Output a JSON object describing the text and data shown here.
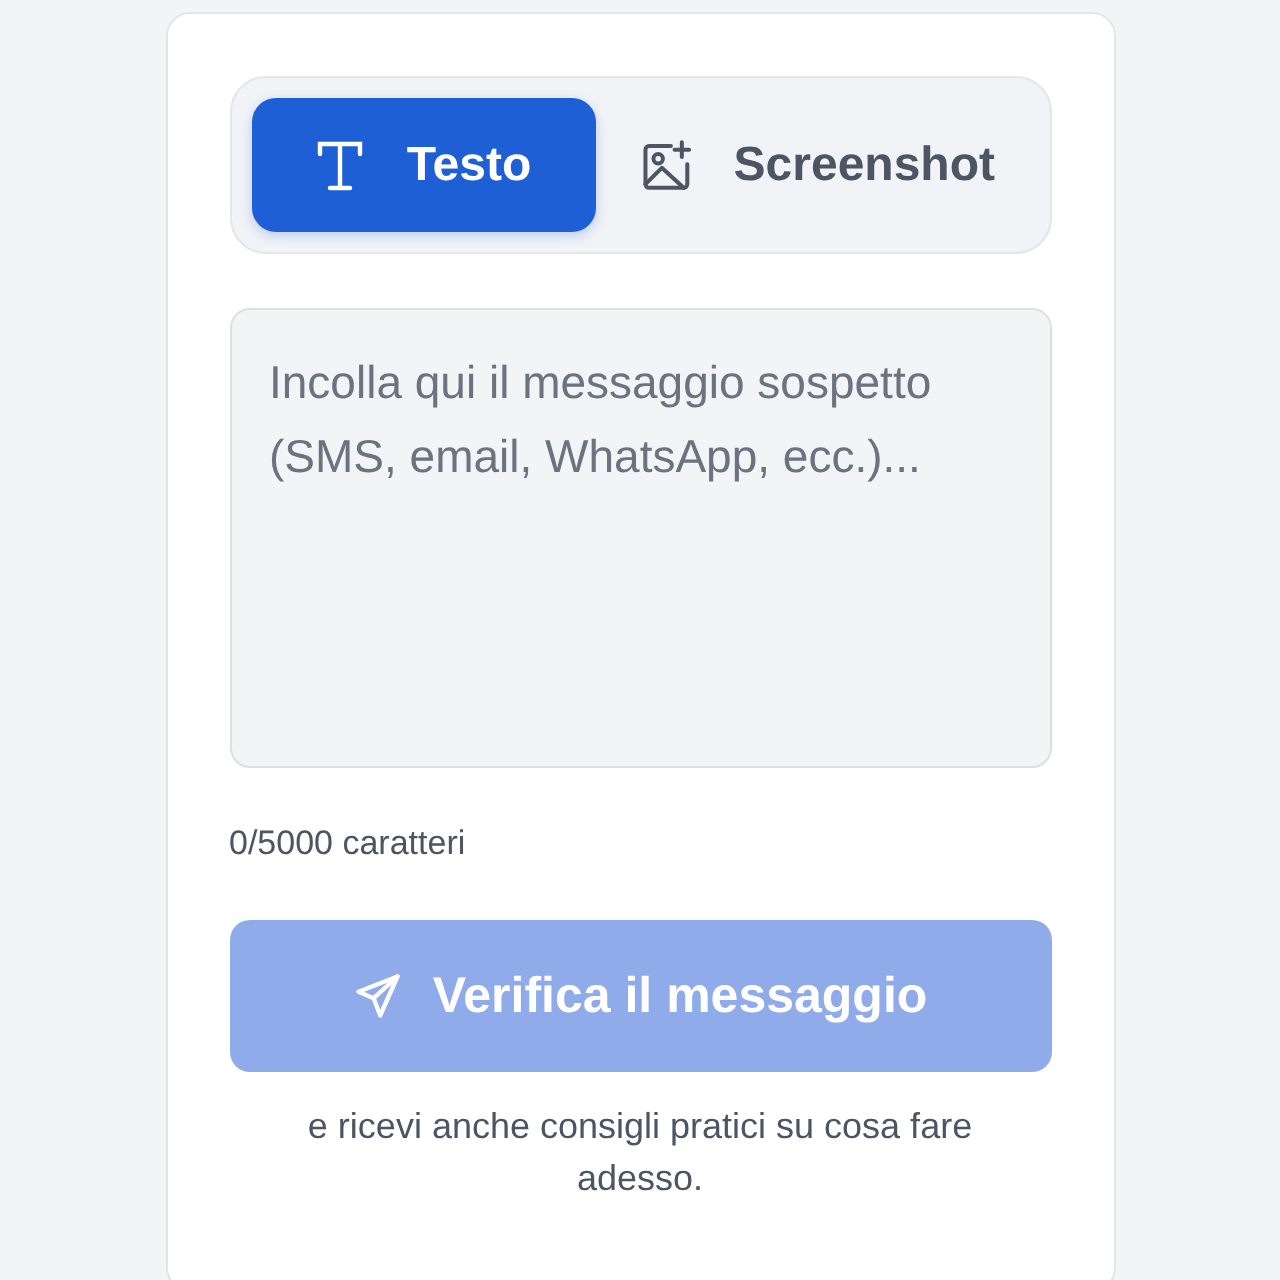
{
  "tabs": [
    {
      "kind": "text",
      "label": "Testo",
      "selected": true
    },
    {
      "kind": "image",
      "label": "Screenshot",
      "selected": false
    }
  ],
  "message": {
    "placeholder": "Incolla qui il messaggio sospetto (SMS, email, WhatsApp, ecc.)..."
  },
  "counter": "0/5000 caratteri",
  "submit": {
    "label": "Verifica il messaggio",
    "disabled": true
  },
  "hint": "e ricevi anche consigli pratici su cosa fare adesso."
}
